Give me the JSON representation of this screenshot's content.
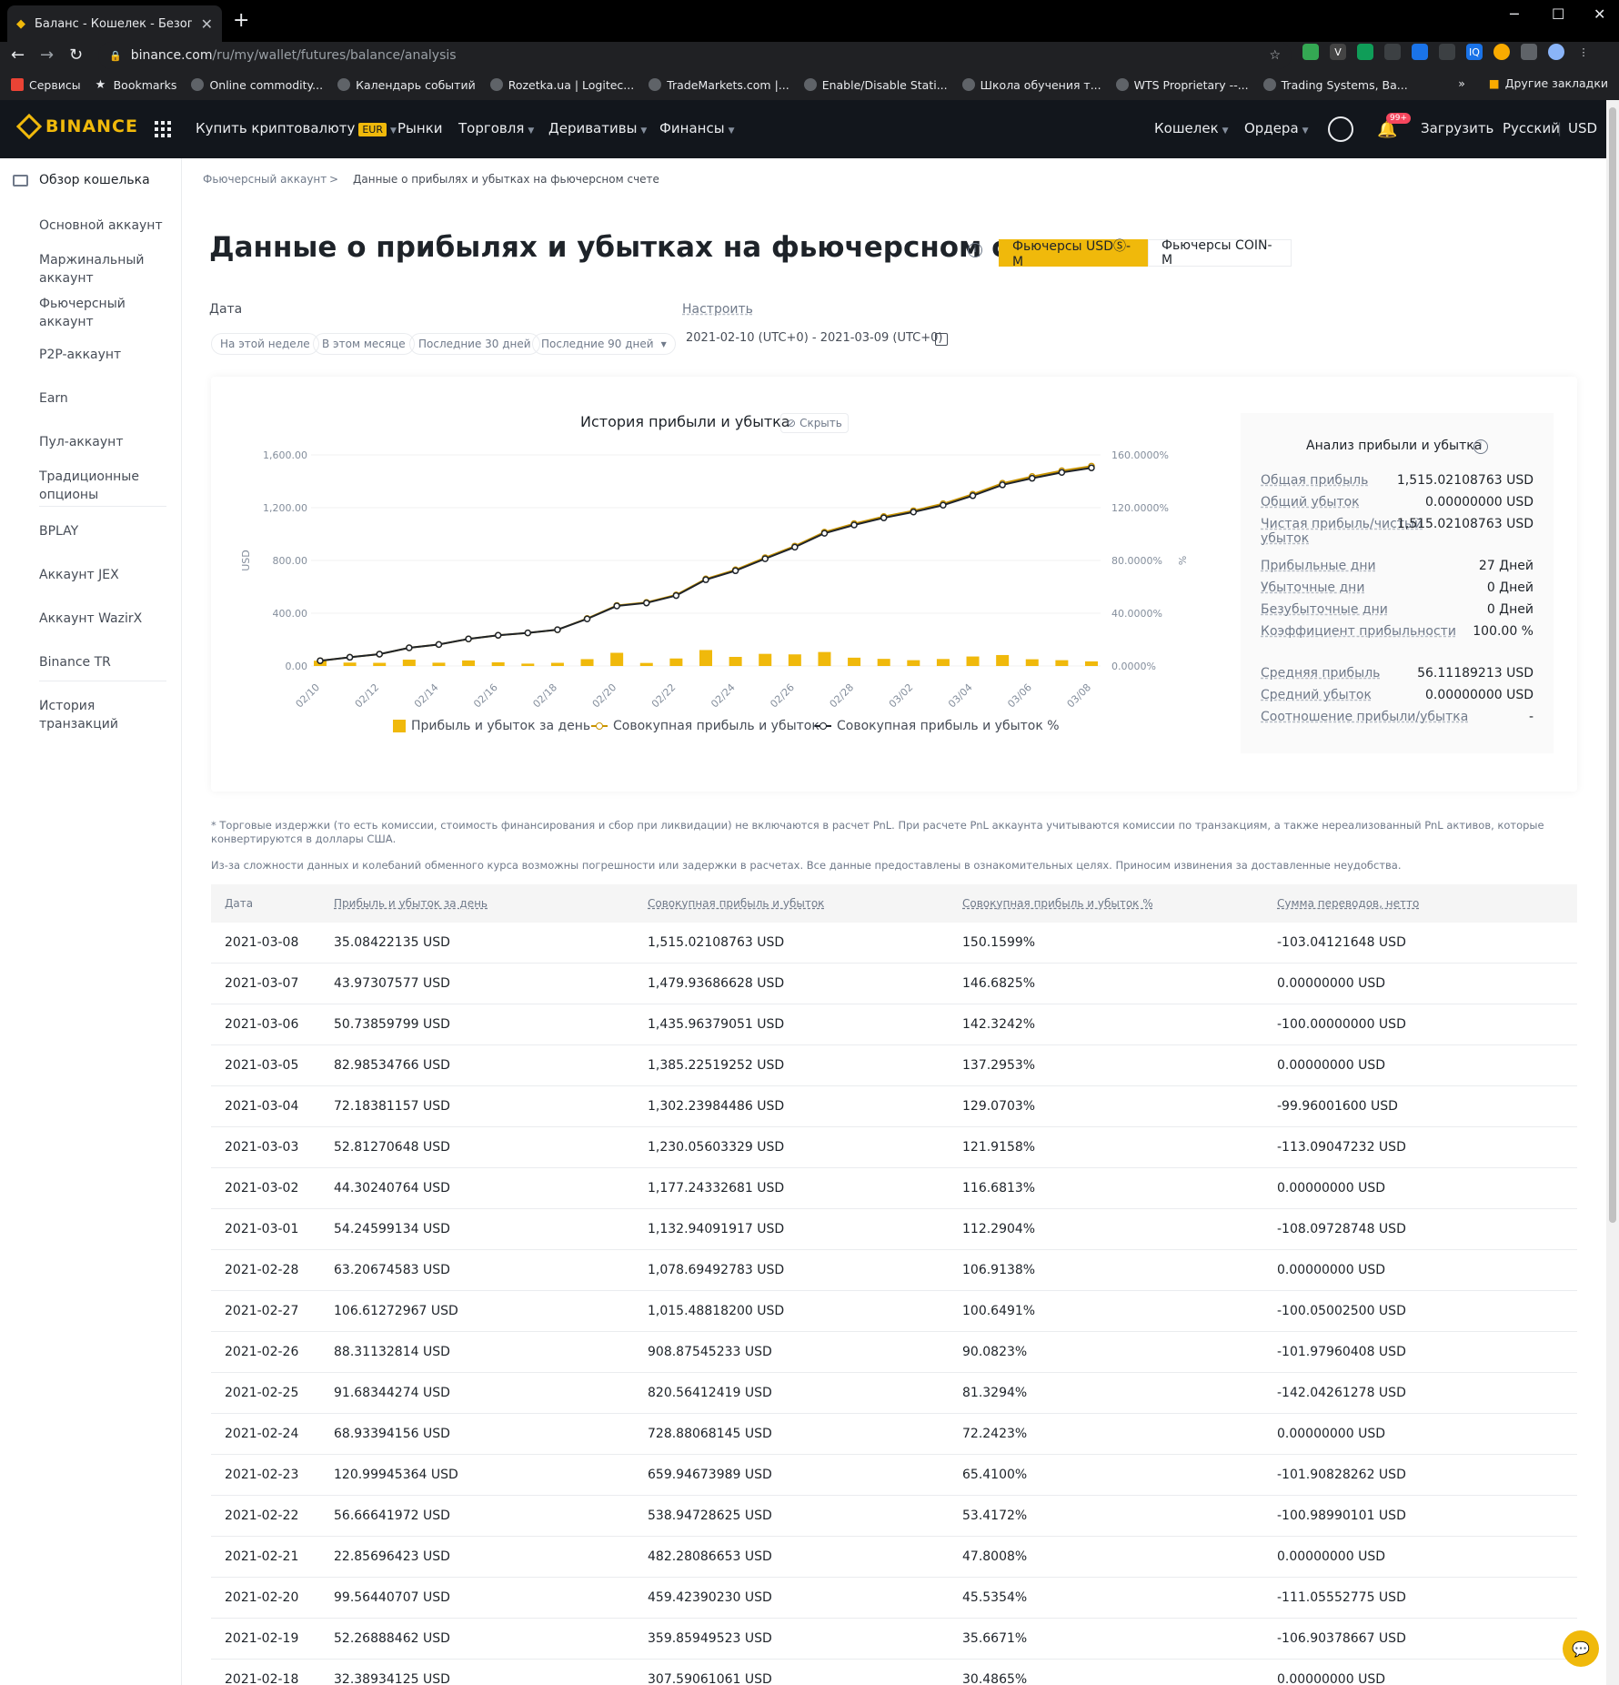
{
  "browser": {
    "tab_title": "Баланс - Кошелек - Безопаснос",
    "url_domain": "binance.com",
    "url_path": "/ru/my/wallet/futures/balance/analysis",
    "bookmarks": [
      "Сервисы",
      "Bookmarks",
      "Online commodity...",
      "Календарь событий",
      "Rozetka.ua | Logitec...",
      "TradeMarkets.com |...",
      "Enable/Disable Stati...",
      "Школа обучения т...",
      "WTS Proprietary --...",
      "Trading Systems, Ba..."
    ],
    "other_bookmarks": "Другие закладки",
    "more": "»"
  },
  "nav": {
    "logo": "BINANCE",
    "buy_crypto": "Купить криптовалюту",
    "eur": "EUR",
    "markets": "Рынки",
    "trade": "Торговля",
    "derivatives": "Деривативы",
    "finance": "Финансы",
    "wallet": "Кошелек",
    "orders": "Ордера",
    "badge": "99+",
    "download": "Загрузить",
    "language": "Русский",
    "currency": "USD"
  },
  "sidebar": {
    "overview": "Обзор кошелька",
    "items": [
      "Основной аккаунт",
      "Маржинальный аккаунт",
      "Фьючерсный аккаунт",
      "P2P-аккаунт",
      "Earn",
      "Пул-аккаунт",
      "Традиционные опционы",
      "BPLAY",
      "Аккаунт JEX",
      "Аккаунт WazirX",
      "Binance TR",
      "История транзакций"
    ]
  },
  "breadcrumb": {
    "parent": "Фьючерсный аккаунт",
    "sep": ">",
    "current": "Данные о прибылях и убытках на фьючерсном счете"
  },
  "page": {
    "title": "Данные о прибылях и убытках на фьючерсном счете",
    "seg_usdm": "Фьючерсы USDⓈ-M",
    "seg_coinm": "Фьючерсы COIN-M",
    "date_label": "Дата",
    "customize": "Настроить",
    "pills": [
      "На этой неделе",
      "В этом месяце",
      "Последние 30 дней",
      "Последние 90 дней"
    ],
    "date_range": "2021-02-10 (UTC+0) - 2021-03-09 (UTC+0)"
  },
  "chart_data": {
    "type": "bar+line",
    "title": "История прибыли и убытка",
    "hide_label": "Скрыть",
    "ylabel": "USD",
    "ylabel_right": "%",
    "ylim": [
      0,
      1600
    ],
    "ylim_right": [
      0,
      160
    ],
    "y_ticks": [
      "1,600.00",
      "1,200.00",
      "800.00",
      "400.00",
      "0.00"
    ],
    "y2_ticks": [
      "160.0000%",
      "120.0000%",
      "80.0000%",
      "40.0000%",
      "0.0000%"
    ],
    "x_ticks": [
      "02/10",
      "02/12",
      "02/14",
      "02/16",
      "02/18",
      "02/20",
      "02/22",
      "02/24",
      "02/26",
      "02/28",
      "03/02",
      "03/04",
      "03/06",
      "03/08"
    ],
    "categories": [
      "02/10",
      "02/11",
      "02/12",
      "02/13",
      "02/14",
      "02/15",
      "02/16",
      "02/17",
      "02/18",
      "02/19",
      "02/20",
      "02/21",
      "02/22",
      "02/23",
      "02/24",
      "02/25",
      "02/26",
      "02/27",
      "02/28",
      "03/01",
      "03/02",
      "03/03",
      "03/04",
      "03/05",
      "03/06",
      "03/07",
      "03/08"
    ],
    "series": [
      {
        "name": "Прибыль и убыток за день",
        "type": "bar",
        "color": "#f0b90b",
        "values": [
          40,
          26,
          24,
          48,
          25,
          42,
          28,
          18,
          24,
          52,
          100,
          23,
          57,
          121,
          69,
          92,
          88,
          106,
          63,
          54,
          44,
          53,
          72,
          83,
          51,
          44,
          35
        ]
      },
      {
        "name": "Совокупная прибыль и убыток",
        "type": "line",
        "color": "#c99400",
        "values": [
          40,
          66,
          90,
          138,
          163,
          205,
          233,
          251,
          275,
          360,
          459,
          482,
          539,
          660,
          729,
          821,
          909,
          1015,
          1079,
          1133,
          1177,
          1230,
          1302,
          1385,
          1436,
          1480,
          1515
        ]
      },
      {
        "name": "Совокупная прибыль и убыток %",
        "type": "line",
        "color": "#1e2329",
        "values": [
          4.0,
          6.6,
          9.0,
          13.8,
          16.3,
          20.5,
          23.3,
          25.1,
          27.5,
          35.7,
          45.5,
          47.8,
          53.4,
          65.4,
          72.2,
          81.3,
          90.1,
          100.6,
          106.9,
          112.3,
          116.7,
          121.9,
          129.1,
          137.3,
          142.3,
          146.7,
          150.2
        ]
      }
    ]
  },
  "analysis": {
    "title": "Анализ прибыли и убытка",
    "rows": [
      {
        "k": "Общая прибыль",
        "v": "1,515.02108763 USD"
      },
      {
        "k": "Общий убыток",
        "v": "0.00000000 USD"
      },
      {
        "k": "Чистая прибыль/чистый убыток",
        "v": "1,515.02108763 USD"
      },
      {
        "k": "Прибыльные дни",
        "v": "27 Дней"
      },
      {
        "k": "Убыточные дни",
        "v": "0 Дней"
      },
      {
        "k": "Безубыточные дни",
        "v": "0 Дней"
      },
      {
        "k": "Коэффициент прибыльности",
        "v": "100.00 %"
      },
      {
        "k": "Средняя прибыль",
        "v": "56.11189213 USD"
      },
      {
        "k": "Средний убыток",
        "v": "0.00000000 USD"
      },
      {
        "k": "Соотношение прибыли/убытка",
        "v": "-"
      }
    ]
  },
  "notes": {
    "n1": "* Торговые издержки (то есть комиссии, стоимость финансирования и сбор при ликвидации) не включаются в расчет PnL. При расчете PnL аккаунта учитываются комиссии по транзакциям, а также нереализованный PnL активов, которые конвертируются в доллары США.",
    "n2": "Из-за сложности данных и колебаний обменного курса возможны погрешности или задержки в расчетах. Все данные предоставлены в ознакомительных целях. Приносим извинения за доставленные неудобства."
  },
  "table": {
    "headers": [
      "Дата",
      "Прибыль и убыток за день",
      "Совокупная прибыль и убыток",
      "Совокупная прибыль и убыток %",
      "Сумма переводов, нетто"
    ],
    "rows": [
      [
        "2021-03-08",
        "35.08422135 USD",
        "1,515.02108763 USD",
        "150.1599%",
        "-103.04121648 USD"
      ],
      [
        "2021-03-07",
        "43.97307577 USD",
        "1,479.93686628 USD",
        "146.6825%",
        "0.00000000 USD"
      ],
      [
        "2021-03-06",
        "50.73859799 USD",
        "1,435.96379051 USD",
        "142.3242%",
        "-100.00000000 USD"
      ],
      [
        "2021-03-05",
        "82.98534766 USD",
        "1,385.22519252 USD",
        "137.2953%",
        "0.00000000 USD"
      ],
      [
        "2021-03-04",
        "72.18381157 USD",
        "1,302.23984486 USD",
        "129.0703%",
        "-99.96001600 USD"
      ],
      [
        "2021-03-03",
        "52.81270648 USD",
        "1,230.05603329 USD",
        "121.9158%",
        "-113.09047232 USD"
      ],
      [
        "2021-03-02",
        "44.30240764 USD",
        "1,177.24332681 USD",
        "116.6813%",
        "0.00000000 USD"
      ],
      [
        "2021-03-01",
        "54.24599134 USD",
        "1,132.94091917 USD",
        "112.2904%",
        "-108.09728748 USD"
      ],
      [
        "2021-02-28",
        "63.20674583 USD",
        "1,078.69492783 USD",
        "106.9138%",
        "0.00000000 USD"
      ],
      [
        "2021-02-27",
        "106.61272967 USD",
        "1,015.48818200 USD",
        "100.6491%",
        "-100.05002500 USD"
      ],
      [
        "2021-02-26",
        "88.31132814 USD",
        "908.87545233 USD",
        "90.0823%",
        "-101.97960408 USD"
      ],
      [
        "2021-02-25",
        "91.68344274 USD",
        "820.56412419 USD",
        "81.3294%",
        "-142.04261278 USD"
      ],
      [
        "2021-02-24",
        "68.93394156 USD",
        "728.88068145 USD",
        "72.2423%",
        "0.00000000 USD"
      ],
      [
        "2021-02-23",
        "120.99945364 USD",
        "659.94673989 USD",
        "65.4100%",
        "-101.90828262 USD"
      ],
      [
        "2021-02-22",
        "56.66641972 USD",
        "538.94728625 USD",
        "53.4172%",
        "-100.98990101 USD"
      ],
      [
        "2021-02-21",
        "22.85696423 USD",
        "482.28086653 USD",
        "47.8008%",
        "0.00000000 USD"
      ],
      [
        "2021-02-20",
        "99.56440707 USD",
        "459.42390230 USD",
        "45.5354%",
        "-111.05552775 USD"
      ],
      [
        "2021-02-19",
        "52.26888462 USD",
        "359.85949523 USD",
        "35.6671%",
        "-106.90378667 USD"
      ],
      [
        "2021-02-18",
        "32.38934125 USD",
        "307.59061061 USD",
        "30.4865%",
        "0.00000000 USD"
      ]
    ]
  }
}
